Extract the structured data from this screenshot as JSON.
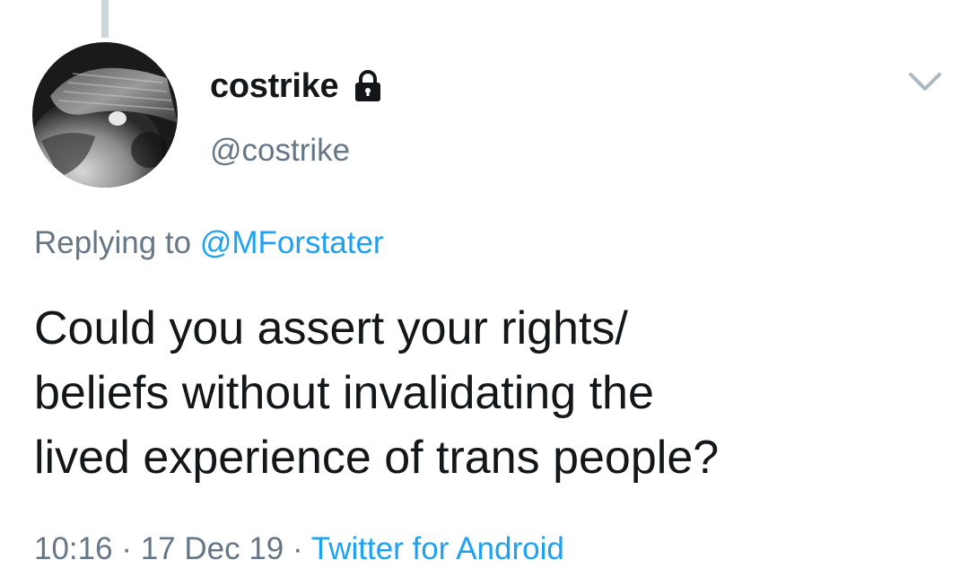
{
  "tweet": {
    "author": {
      "display_name": "costrike",
      "handle": "@costrike",
      "protected_icon": "lock-icon"
    },
    "menu_icon": "chevron-down-icon",
    "replying_to": {
      "prefix": "Replying to",
      "mention": "@MForstater"
    },
    "text_lines": [
      "Could you assert your rights/",
      "beliefs without invalidating the",
      "lived experience of trans people?"
    ],
    "meta": {
      "time": "10:16",
      "separator": "·",
      "date": "17 Dec 19",
      "source": "Twitter for Android"
    }
  },
  "colors": {
    "text_primary": "#14171a",
    "text_secondary": "#657786",
    "link": "#1da1f2",
    "thread_line": "#ccd6dd"
  }
}
